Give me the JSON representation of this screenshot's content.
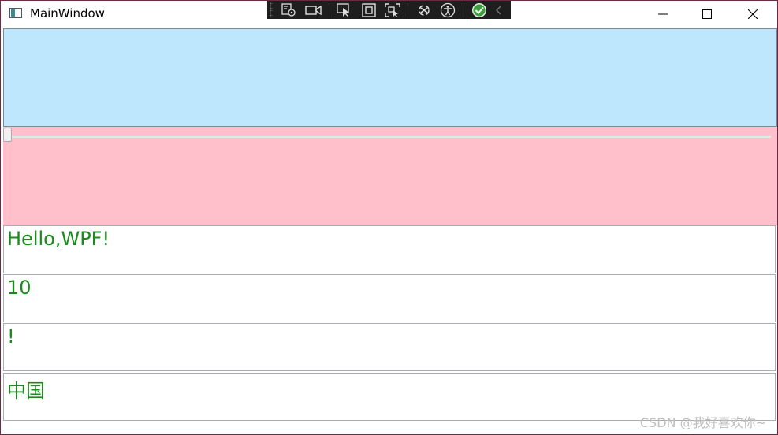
{
  "window": {
    "title": "MainWindow",
    "app_icon": "window-app-icon",
    "controls": {
      "minimize_icon": "minimize-icon",
      "maximize_icon": "maximize-icon",
      "close_icon": "close-icon"
    }
  },
  "debug_toolbar": {
    "icons": [
      "live-visual-tree-icon",
      "record-video-icon",
      "select-element-icon",
      "display-layout-adorners-icon",
      "track-focus-icon",
      "binding-failures-icon",
      "accessibility-icon",
      "checkmark-icon",
      "collapse-chevron-icon"
    ]
  },
  "top_panel": {
    "background": "#bee6fc"
  },
  "slider": {
    "value": 0,
    "thumb_icon": "slider-thumb"
  },
  "pink_panel": {
    "background": "#ffc0cb"
  },
  "textboxes": [
    {
      "text": "Hello,WPF!"
    },
    {
      "text": "10"
    },
    {
      "text": "!"
    },
    {
      "text": "中国"
    }
  ],
  "text_color": "#1c8a1c",
  "watermark": "CSDN @我好喜欢你~"
}
